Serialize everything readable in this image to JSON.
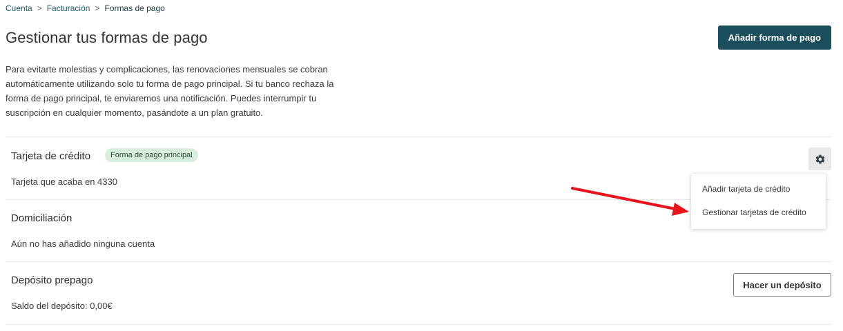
{
  "breadcrumb": {
    "items": [
      "Cuenta",
      "Facturación",
      "Formas de pago"
    ],
    "separator": ">"
  },
  "header": {
    "title": "Gestionar tus formas de pago",
    "add_button_label": "Añadir forma de pago"
  },
  "intro": {
    "text": "Para evitarte molestias y complicaciones, las renovaciones mensuales se cobran automáticamente utilizando solo tu forma de pago principal. Si tu banco rechaza la forma de pago principal, te enviaremos una notificación. Puedes interrumpir tu suscripción en cualquier momento, pasándote a un plan gratuito."
  },
  "sections": {
    "credit_card": {
      "title": "Tarjeta de crédito",
      "badge": "Forma de pago principal",
      "subtitle": "Tarjeta que acaba en 4330",
      "menu": {
        "icon": "gear-icon",
        "items": [
          "Añadir tarjeta de crédito",
          "Gestionar tarjetas de crédito"
        ]
      }
    },
    "direct_debit": {
      "title": "Domiciliación",
      "subtitle": "Aún no has añadido ninguna cuenta"
    },
    "prepaid_deposit": {
      "title": "Depósito prepago",
      "subtitle": "Saldo del depósito: 0,00€",
      "button_label": "Hacer un depósito"
    }
  },
  "colors": {
    "primary_button": "#1c4f5e",
    "badge_bg": "#d8eedd",
    "annotation_arrow": "#e8141b"
  }
}
